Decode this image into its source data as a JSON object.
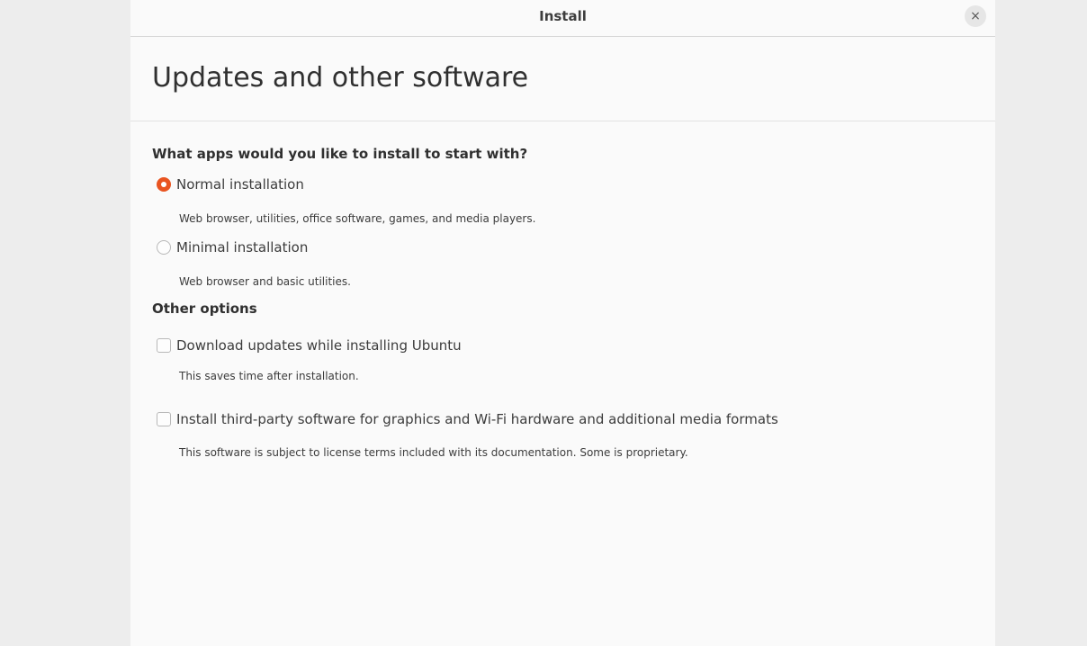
{
  "window": {
    "title": "Install",
    "close_glyph": "×",
    "close_icon": "close-icon"
  },
  "page": {
    "title": "Updates and other software"
  },
  "apps_section": {
    "heading": "What apps would you like to install to start with?",
    "options": [
      {
        "label": "Normal installation",
        "description": "Web browser, utilities, office software, games, and media players.",
        "checked": true
      },
      {
        "label": "Minimal installation",
        "description": "Web browser and basic utilities.",
        "checked": false
      }
    ]
  },
  "other_section": {
    "heading": "Other options",
    "options": [
      {
        "label": "Download updates while installing Ubuntu",
        "description": "This saves time after installation.",
        "checked": false
      },
      {
        "label": "Install third-party software for graphics and Wi-Fi hardware and additional media formats",
        "description": "This software is subject to license terms included with its documentation. Some is proprietary.",
        "checked": false
      }
    ]
  },
  "colors": {
    "accent": "#e95420",
    "window_bg": "#fafafa",
    "desktop_bg": "#ededed"
  }
}
